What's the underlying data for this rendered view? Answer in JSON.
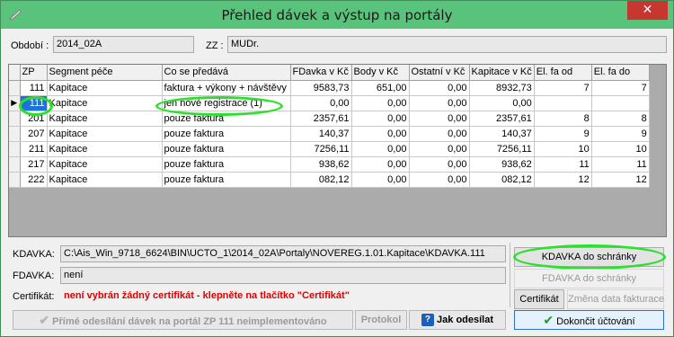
{
  "window": {
    "title": "Přehled dávek a výstup na portály",
    "close_glyph": "✕"
  },
  "header": {
    "obdobi_label": "Období :",
    "obdobi_value": "2014_02A",
    "zz_label": "ZZ :",
    "zz_value": "MUDr."
  },
  "grid": {
    "columns": [
      "ZP",
      "Segment péče",
      "Co se předává",
      "FDavka v Kč",
      "Body v Kč",
      "Ostatní v Kč",
      "Kapitace v Kč",
      "El. fa od",
      "El. fa do"
    ],
    "rows": [
      [
        "111",
        "Kapitace",
        "faktura + výkony + návštěvy",
        "9583,73",
        "651,00",
        "0,00",
        "8932,73",
        "7",
        "7"
      ],
      [
        "111",
        "Kapitace",
        "jen nové registrace (1)",
        "0,00",
        "0,00",
        "0,00",
        "0,00",
        "",
        ""
      ],
      [
        "201",
        "Kapitace",
        "pouze faktura",
        "2357,61",
        "0,00",
        "0,00",
        "2357,61",
        "8",
        "8"
      ],
      [
        "207",
        "Kapitace",
        "pouze faktura",
        "140,37",
        "0,00",
        "0,00",
        "140,37",
        "9",
        "9"
      ],
      [
        "211",
        "Kapitace",
        "pouze faktura",
        "7256,11",
        "0,00",
        "0,00",
        "7256,11",
        "10",
        "10"
      ],
      [
        "217",
        "Kapitace",
        "pouze faktura",
        "938,62",
        "0,00",
        "0,00",
        "938,62",
        "11",
        "11"
      ],
      [
        "222",
        "Kapitace",
        "pouze faktura",
        "082,12",
        "0,00",
        "0,00",
        "082,12",
        "12",
        "12"
      ]
    ],
    "current_row_marker": "▶"
  },
  "details": {
    "kdavka_label": "KDAVKA:",
    "kdavka_value": "C:\\Ais_Win_9718_6624\\BIN\\UCTO_1\\2014_02A\\Portaly\\NOVEREG.1.01.Kapitace\\KDAVKA.111",
    "fdavka_label": "FDAVKA:",
    "fdavka_value": "není",
    "cert_label": "Certifikát:",
    "cert_value": "není vybrán žádný certifikát - klepněte na tlačítko \"Certifikát\""
  },
  "buttons": {
    "kdavka_clip": "KDAVKA do schránky",
    "fdavka_clip": "FDAVKA do schránky",
    "certifikat": "Certifikát",
    "zmena": "Změna data fakturace",
    "prime": "Přímé odesílání dávek na portál ZP 111 neimplementováno",
    "protokol": "Protokol",
    "jak_odesilat": "Jak odesílat",
    "dokoncit": "Dokončit účtování"
  },
  "colors": {
    "titlebar": "#59c37c",
    "close": "#c7372f",
    "selection": "#1e73d8",
    "highlight_oval": "#2ee02e",
    "warning_text": "#e00000"
  }
}
